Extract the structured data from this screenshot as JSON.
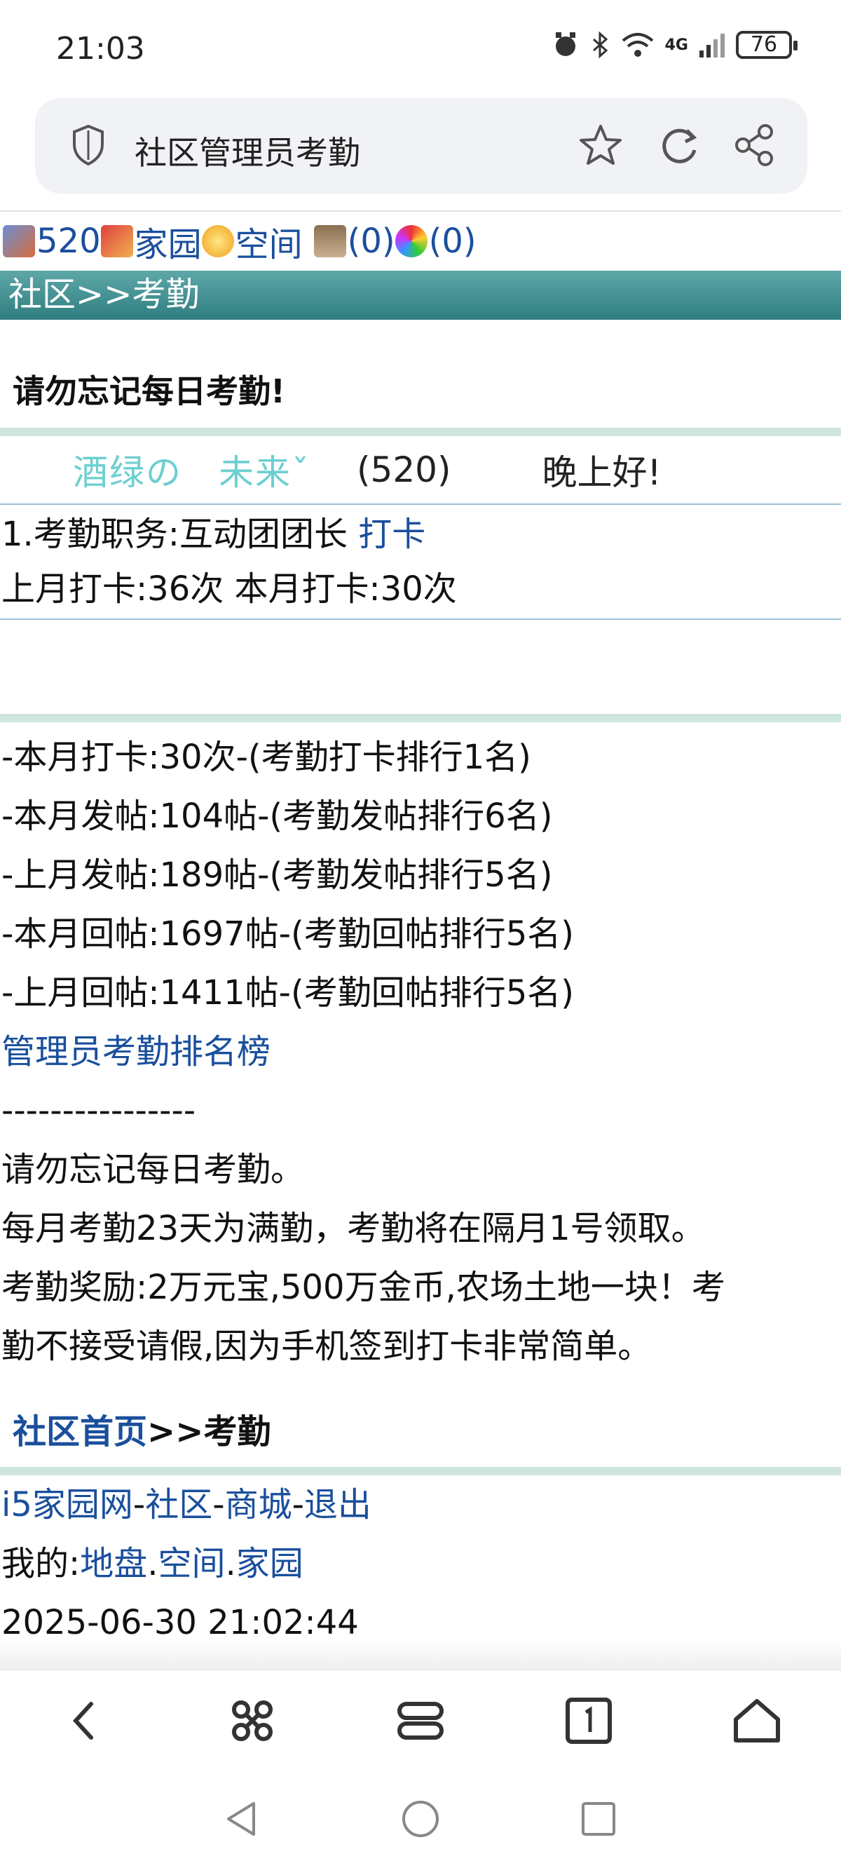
{
  "status_bar": {
    "time": "21:03",
    "battery": "76",
    "network": "4G"
  },
  "address_bar": {
    "title": "社区管理员考勤"
  },
  "nav": {
    "id_count": "520",
    "home_label": "家园",
    "space_label": "空间",
    "bank_count": "(0)",
    "lottery_count": "(0)"
  },
  "header": {
    "title": "社区>>考勤"
  },
  "reminder": "请勿忘记每日考勤!",
  "user": {
    "nickname": "酒绿の　未来ˇ",
    "id": "(520)",
    "greeting": "晚上好!"
  },
  "duty": {
    "role_text": "1.考勤职务:互动团团长 ",
    "punch_link": "打卡",
    "counts": "上月打卡:36次 本月打卡:30次"
  },
  "stats": [
    "-本月打卡:30次-(考勤打卡排行1名)",
    "-本月发帖:104帖-(考勤发帖排行6名)",
    "-上月发帖:189帖-(考勤发帖排行5名)",
    "-本月回帖:1697帖-(考勤回帖排行5名)",
    "-上月回帖:1411帖-(考勤回帖排行5名)"
  ],
  "ranking_link": "管理员考勤排名榜",
  "divider": "----------------",
  "notes": [
    "请勿忘记每日考勤。",
    "每月考勤23天为满勤，考勤将在隔月1号领取。",
    "考勤奖励:2万元宝,500万金币,农场土地一块！考",
    "勤不接受请假,因为手机签到打卡非常简单。"
  ],
  "breadcrumb": {
    "home_link": "社区首页",
    "rest": ">>考勤"
  },
  "footer": {
    "site": "i5家园网",
    "dash1": "-",
    "community": "社区",
    "dash2": "-",
    "mall": "商城",
    "dash3": "-",
    "logout": "退出",
    "mine_label": "我的:",
    "turf": "地盘",
    "dot1": ".",
    "space": "空间",
    "dot2": ".",
    "home": "家园",
    "timestamp": "2025-06-30 21:02:44"
  },
  "colors": {
    "header_bar": "#2f7e80",
    "link": "#1a4f9c",
    "nickname": "#6ccfd0",
    "separator": "#cfe6de"
  },
  "icons": [
    "shield-icon",
    "star-icon",
    "reload-icon",
    "share-icon",
    "back-icon",
    "command-icon",
    "tabs-stack-icon",
    "tab-count-icon",
    "home-icon"
  ]
}
